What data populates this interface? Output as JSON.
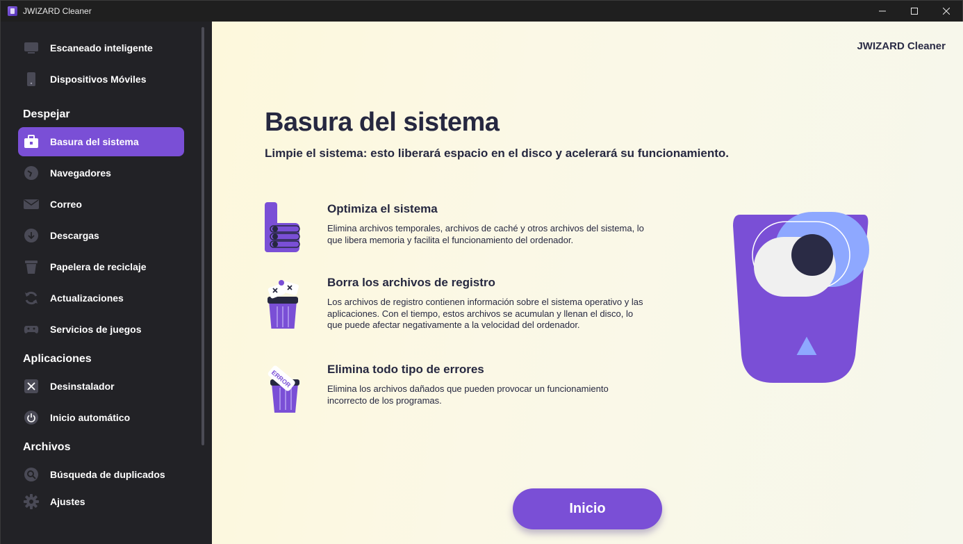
{
  "window": {
    "title": "JWIZARD Cleaner",
    "controls": {
      "minimize": "—",
      "maximize": "☐",
      "close": "✕"
    }
  },
  "sidebar": {
    "top_items": [
      {
        "label": "Escaneado inteligente",
        "icon": "monitor-icon"
      },
      {
        "label": "Dispositivos Móviles",
        "icon": "phone-icon"
      }
    ],
    "sections": [
      {
        "title": "Despejar",
        "items": [
          {
            "label": "Basura del sistema",
            "icon": "briefcase-icon",
            "active": true
          },
          {
            "label": "Navegadores",
            "icon": "browser-icon"
          },
          {
            "label": "Correo",
            "icon": "mail-icon"
          },
          {
            "label": "Descargas",
            "icon": "download-icon"
          },
          {
            "label": "Papelera de reciclaje",
            "icon": "trash-icon"
          },
          {
            "label": "Actualizaciones",
            "icon": "refresh-icon"
          },
          {
            "label": "Servicios de juegos",
            "icon": "gamepad-icon"
          }
        ]
      },
      {
        "title": "Aplicaciones",
        "items": [
          {
            "label": "Desinstalador",
            "icon": "uninstall-icon"
          },
          {
            "label": "Inicio automático",
            "icon": "power-icon"
          }
        ]
      },
      {
        "title": "Archivos",
        "items": [
          {
            "label": "Búsqueda de duplicados",
            "icon": "duplicate-search-icon"
          },
          {
            "label": "Ajustes",
            "icon": "gear-icon"
          }
        ]
      }
    ]
  },
  "main": {
    "brand": "JWIZARD Cleaner",
    "title": "Basura del sistema",
    "subtitle": "Limpie el sistema: esto liberará espacio en el disco y acelerará su funcionamiento.",
    "features": [
      {
        "title": "Optimiza el sistema",
        "description": "Elimina archivos temporales, archivos de caché y otros archivos del sistema, lo que libera memoria y facilita el funcionamiento del ordenador.",
        "icon": "thumbs-up-icon"
      },
      {
        "title": "Borra los archivos de registro",
        "description": "Los archivos de registro contienen información sobre el sistema operativo y las aplicaciones. Con el tiempo, estos archivos se acumulan y llenan el disco, lo que puede afectar negativamente a la velocidad del ordenador.",
        "icon": "trash-bin-files-icon"
      },
      {
        "title": "Elimina todo tipo de errores",
        "description": "Elimina los archivos dañados que pueden provocar un funcionamiento incorrecto de los programas.",
        "icon": "error-bin-icon",
        "icon_text": "ERROR"
      }
    ],
    "start_button": "Inicio"
  },
  "colors": {
    "accent": "#7a4fd6",
    "accent_light": "#8ea8ff",
    "dark_text": "#262840",
    "sidebar_bg": "#222226"
  }
}
